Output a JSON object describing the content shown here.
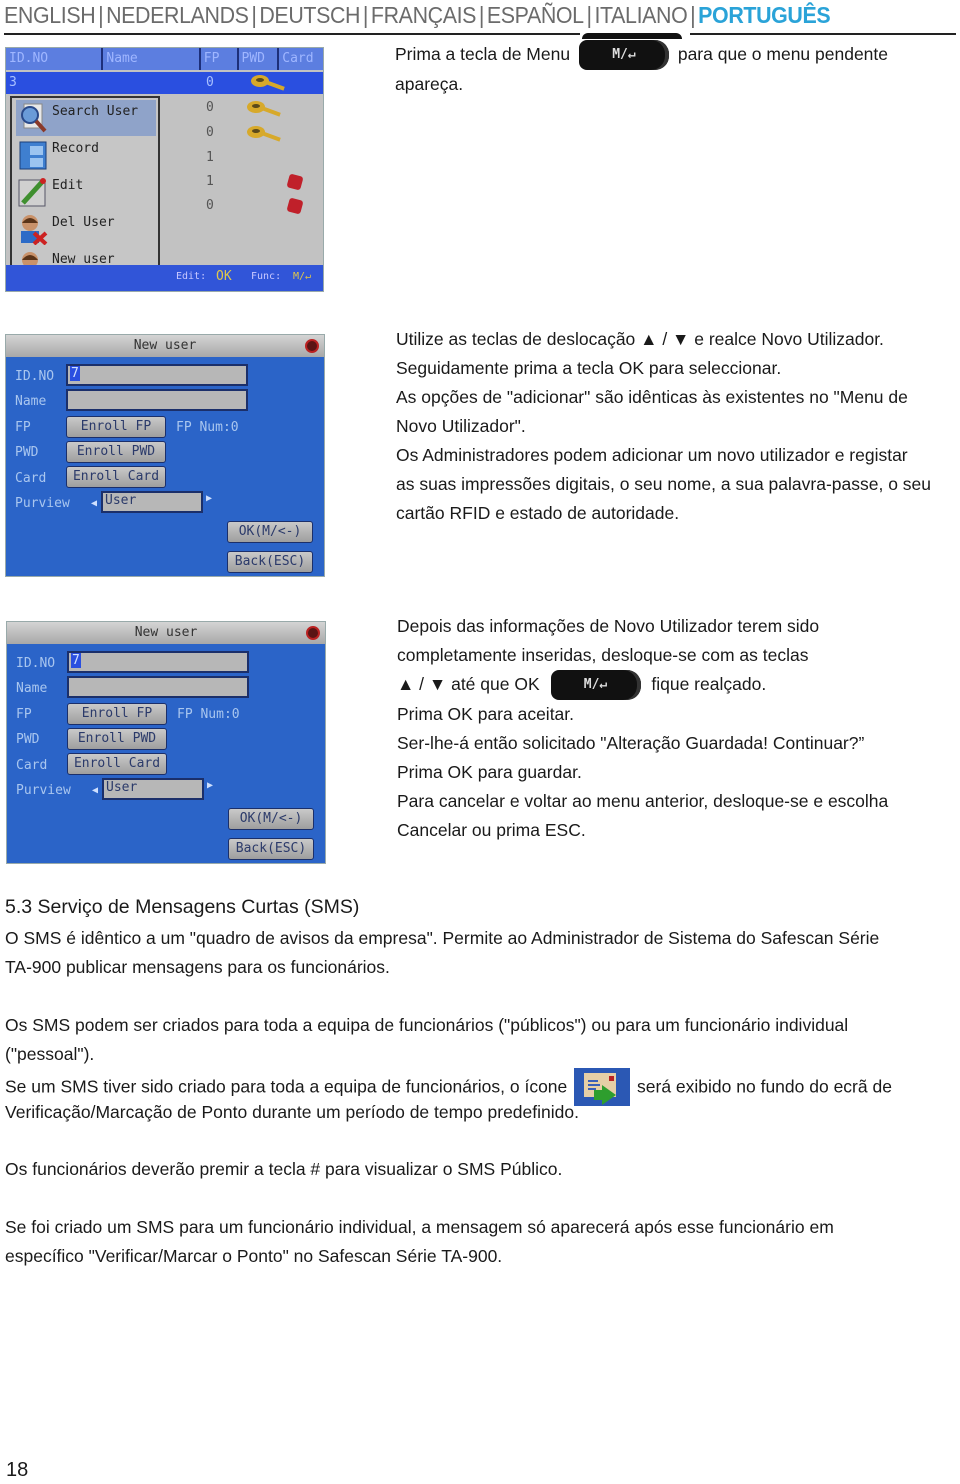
{
  "header": {
    "languages": [
      {
        "label": "ENGLISH",
        "active": false
      },
      {
        "label": "NEDERLANDS",
        "active": false
      },
      {
        "label": "DEUTSCH",
        "active": false
      },
      {
        "label": "FRANÇAIS",
        "active": false
      },
      {
        "label": "ESPAÑOL",
        "active": false
      },
      {
        "label": "ITALIANO",
        "active": false
      },
      {
        "label": "PORTUGUÊS",
        "active": true
      }
    ],
    "separator": "|",
    "accent_color": "#2aa3d8"
  },
  "key_label": "M/↵",
  "section1": {
    "text_before_key": "Prima a tecla de Menu",
    "text_after_key": "para que o menu pendente",
    "line2": "apareça."
  },
  "screen_user_list": {
    "columns": [
      "ID.NO",
      "Name",
      "FP",
      "PWD",
      "Card"
    ],
    "selected_row": {
      "id": "3",
      "fp": "0"
    },
    "fp_values": [
      "0",
      "0",
      "1",
      "1",
      "0"
    ],
    "menu_items": [
      {
        "label": "Search User",
        "icon": "search-user-icon",
        "active": true
      },
      {
        "label": "Record",
        "icon": "record-cabinet-icon",
        "active": false
      },
      {
        "label": "Edit",
        "icon": "edit-pencil-icon",
        "active": false
      },
      {
        "label": "Del User",
        "icon": "delete-user-icon",
        "active": false
      },
      {
        "label": "New user",
        "icon": "new-user-icon",
        "active": false
      }
    ],
    "footer": {
      "edit_label": "Edit:",
      "edit_key": "OK",
      "func_label": "Func:",
      "func_key": "M/↵"
    }
  },
  "screen_new_user": {
    "title": "New user",
    "labels": {
      "id": "ID.NO",
      "name": "Name",
      "fp": "FP",
      "pwd": "PWD",
      "card": "Card",
      "purview": "Purview"
    },
    "id_value": "7",
    "name_value": "",
    "enroll_fp": "Enroll FP",
    "fp_num": "FP Num:0",
    "enroll_pwd": "Enroll PWD",
    "enroll_card": "Enroll Card",
    "purview_value": "User",
    "ok_button": "OK(M/<-)",
    "back_button": "Back(ESC)"
  },
  "section2": {
    "lines": [
      "Utilize as teclas de deslocação ▲ / ▼  e realce Novo Utilizador.",
      "Seguidamente prima a tecla OK para seleccionar.",
      "As opções de \"adicionar\" são idênticas às existentes no \"Menu de",
      "Novo Utilizador\".",
      "Os Administradores podem adicionar um novo utilizador e registar",
      "as suas impressões digitais, o seu nome, a sua palavra-passe, o seu",
      "cartão RFID e estado de autoridade."
    ]
  },
  "section3": {
    "line1": "Depois das informações de Novo Utilizador terem sido",
    "line2": "completamente inseridas, desloque-se com as teclas",
    "line3_before": "▲ / ▼  até que OK",
    "line3_after": "fique realçado.",
    "lines_after": [
      "Prima OK para aceitar.",
      "Ser-lhe-á então solicitado \"Alteração Guardada! Continuar?”",
      "Prima OK para guardar.",
      "Para cancelar e voltar ao menu anterior, desloque-se e escolha",
      "Cancelar ou prima ESC."
    ]
  },
  "sms_section": {
    "heading": "5.3 Serviço de Mensagens Curtas (SMS)",
    "para1": [
      "O SMS é idêntico a um \"quadro de avisos da empresa\". Permite ao Administrador de Sistema do Safescan Série",
      "TA-900 publicar mensagens para os funcionários."
    ],
    "para2": [
      "Os SMS podem ser criados para toda a equipa de funcionários (\"públicos\") ou para um funcionário individual",
      "(\"pessoal\")."
    ],
    "para3_before_icon": "Se um SMS tiver sido criado para toda a equipa de funcionários, o ícone",
    "para3_after_icon": "será exibido no fundo do ecrã de",
    "para3_line2": "Verificação/Marcação de Ponto durante um período de tempo predefinido.",
    "para4": "Os funcionários deverão premir a tecla # para visualizar o SMS Público.",
    "para5": [
      "Se foi criado um SMS para um funcionário individual, a mensagem só aparecerá após esse funcionário em",
      "específico \"Verificar/Marcar o Ponto\" no Safescan Série TA-900."
    ]
  },
  "page_number": "18"
}
